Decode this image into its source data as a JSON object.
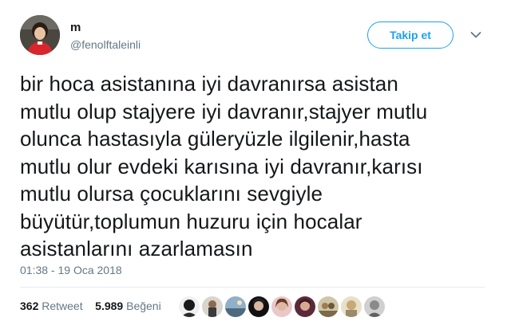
{
  "author": {
    "name": "m",
    "handle": "@fenolftaleinli",
    "avatar_icon": "profile-photo-child-red-shirt"
  },
  "follow_button": {
    "label": "Takip et",
    "color": "#1da1f2"
  },
  "menu": {
    "icon": "chevron-down-icon"
  },
  "tweet": {
    "lines": [
      "bir hoca asistanına iyi davranırsa asistan",
      "mutlu olup stajyere iyi davranır,stajyer mutlu",
      "olunca hastasıyla güleryüzle ilgilenir,hasta",
      "mutlu olur evdeki karısına iyi davranır,karısı",
      "mutlu olursa çocuklarını sevgiyle",
      "büyütür,toplumun huzuru için hocalar",
      "asistanlarını azarlamasın"
    ],
    "timestamp": "01:38 - 19 Oca 2018"
  },
  "stats": {
    "retweet_count": "362",
    "retweet_label": "Retweet",
    "like_count": "5.989",
    "like_label": "Beğeni"
  },
  "likers": [
    {
      "icon": "liker-avatar-1",
      "color": "#2a2a2a"
    },
    {
      "icon": "liker-avatar-2",
      "color": "#5a4a3a"
    },
    {
      "icon": "liker-avatar-3",
      "color": "#6f8fa8"
    },
    {
      "icon": "liker-avatar-4",
      "color": "#1e1e1e"
    },
    {
      "icon": "liker-avatar-5",
      "color": "#c98a8a"
    },
    {
      "icon": "liker-avatar-6",
      "color": "#8a4a5a"
    },
    {
      "icon": "liker-avatar-7",
      "color": "#7a6a4a"
    },
    {
      "icon": "liker-avatar-8",
      "color": "#9a8a6a"
    },
    {
      "icon": "liker-avatar-9",
      "color": "#b0b0b0"
    }
  ]
}
